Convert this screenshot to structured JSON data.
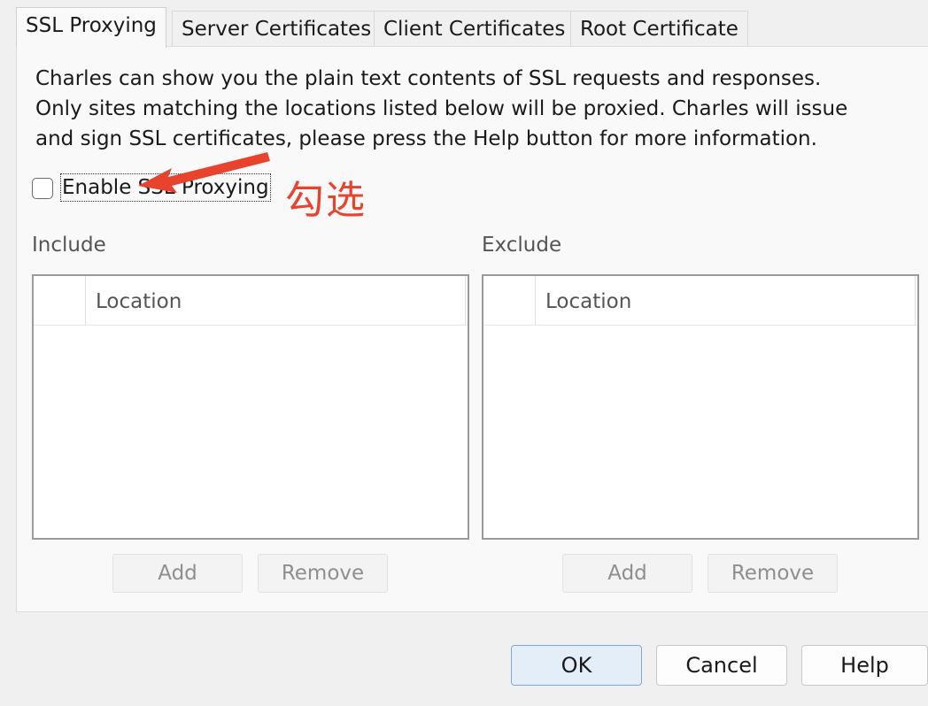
{
  "tabs": [
    {
      "label": "SSL Proxying",
      "active": true
    },
    {
      "label": "Server Certificates",
      "active": false
    },
    {
      "label": "Client Certificates",
      "active": false
    },
    {
      "label": "Root Certificate",
      "active": false
    }
  ],
  "description": "Charles can show you the plain text contents of SSL requests and responses.\nOnly sites matching the locations listed below will be proxied. Charles will issue\nand sign SSL certificates, please press the Help button for more information.",
  "enable_ssl": {
    "label": "Enable SSL Proxying",
    "checked": false
  },
  "annotation": {
    "text": "勾选",
    "color": "#e8432d"
  },
  "include": {
    "label": "Include",
    "column": "Location",
    "add": "Add",
    "remove": "Remove"
  },
  "exclude": {
    "label": "Exclude",
    "column": "Location",
    "add": "Add",
    "remove": "Remove"
  },
  "dialog_buttons": {
    "ok": "OK",
    "cancel": "Cancel",
    "help": "Help"
  }
}
